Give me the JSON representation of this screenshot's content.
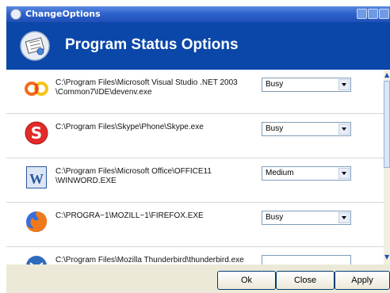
{
  "window": {
    "title": "ChangeOptions",
    "header_title": "Program Status Options"
  },
  "programs": [
    {
      "path": "C:\\Program Files\\Microsoft Visual Studio .NET 2003\n\\Common7\\IDE\\devenv.exe",
      "status": "Busy",
      "icon": "visual-studio-icon"
    },
    {
      "path": "C:\\Program Files\\Skype\\Phone\\Skype.exe",
      "status": "Busy",
      "icon": "skype-icon"
    },
    {
      "path": "C:\\Program Files\\Microsoft Office\\OFFICE11\n\\WINWORD.EXE",
      "status": "Medium",
      "icon": "word-icon"
    },
    {
      "path": "C:\\PROGRA~1\\MOZILL~1\\FIREFOX.EXE",
      "status": "Busy",
      "icon": "firefox-icon"
    },
    {
      "path": "C:\\Program Files\\Mozilla Thunderbird\\thunderbird.exe",
      "status": "",
      "icon": "thunderbird-icon"
    }
  ],
  "buttons": {
    "ok": "Ok",
    "close": "Close",
    "apply": "Apply"
  },
  "colors": {
    "header": "#0a47a8",
    "titlebar": "#2e63cc",
    "dialog_bg": "#ece9d8"
  }
}
